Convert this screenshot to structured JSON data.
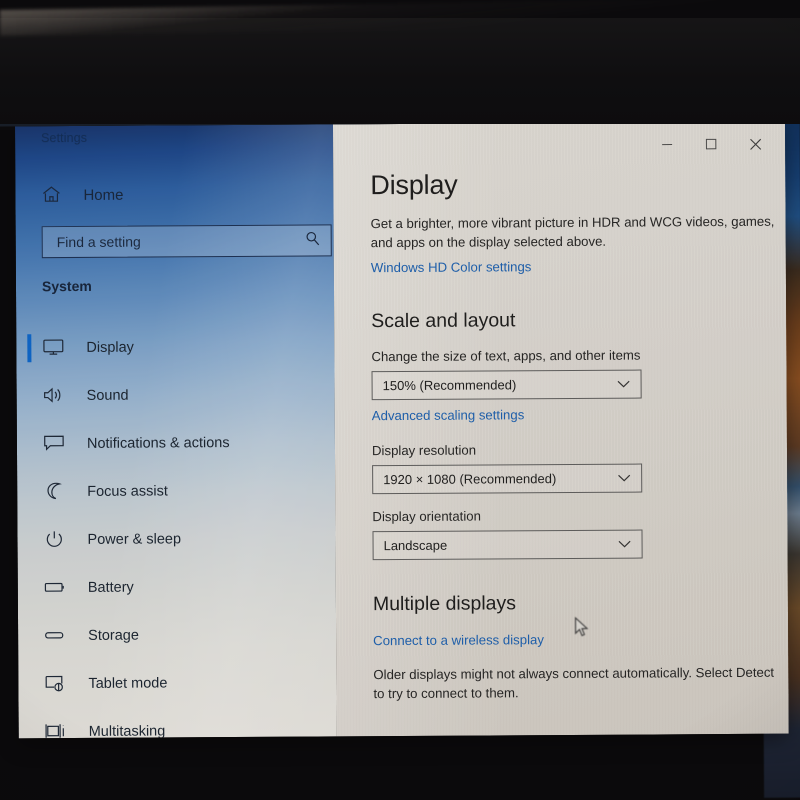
{
  "window": {
    "title": "Settings",
    "controls": [
      {
        "name": "minimize",
        "glyph": "minimize-icon"
      },
      {
        "name": "maximize",
        "glyph": "maximize-icon"
      },
      {
        "name": "close",
        "glyph": "close-icon"
      }
    ]
  },
  "sidebar": {
    "home_label": "Home",
    "home_icon": "home-icon",
    "search": {
      "placeholder": "Find a setting",
      "value": "Find a setting",
      "icon": "search-icon"
    },
    "section_title": "System",
    "items": [
      {
        "label": "Display",
        "icon": "monitor-icon",
        "selected": true
      },
      {
        "label": "Sound",
        "icon": "speaker-icon",
        "selected": false
      },
      {
        "label": "Notifications & actions",
        "icon": "notification-icon",
        "selected": false
      },
      {
        "label": "Focus assist",
        "icon": "moon-icon",
        "selected": false
      },
      {
        "label": "Power & sleep",
        "icon": "power-icon",
        "selected": false
      },
      {
        "label": "Battery",
        "icon": "battery-icon",
        "selected": false
      },
      {
        "label": "Storage",
        "icon": "storage-icon",
        "selected": false
      },
      {
        "label": "Tablet mode",
        "icon": "tablet-icon",
        "selected": false
      },
      {
        "label": "Multitasking",
        "icon": "multitasking-icon",
        "selected": false
      }
    ]
  },
  "main": {
    "page_title": "Display",
    "hdr_description": "Get a brighter, more vibrant picture in HDR and WCG videos, games, and apps on the display selected above.",
    "hd_color_link": "Windows HD Color settings",
    "scale_section": {
      "title": "Scale and layout",
      "scale_label": "Change the size of text, apps, and other items",
      "scale_value": "150% (Recommended)",
      "advanced_link": "Advanced scaling settings",
      "resolution_label": "Display resolution",
      "resolution_value": "1920 × 1080 (Recommended)",
      "orientation_label": "Display orientation",
      "orientation_value": "Landscape"
    },
    "multiple_displays": {
      "title": "Multiple displays",
      "wireless_link": "Connect to a wireless display",
      "note": "Older displays might not always connect automatically. Select Detect to try to connect to them."
    }
  },
  "colors": {
    "accent": "#0a64c8",
    "link": "#1b5fae",
    "sidebar_top": "#15336b",
    "content_bg": "#dedbd5"
  }
}
